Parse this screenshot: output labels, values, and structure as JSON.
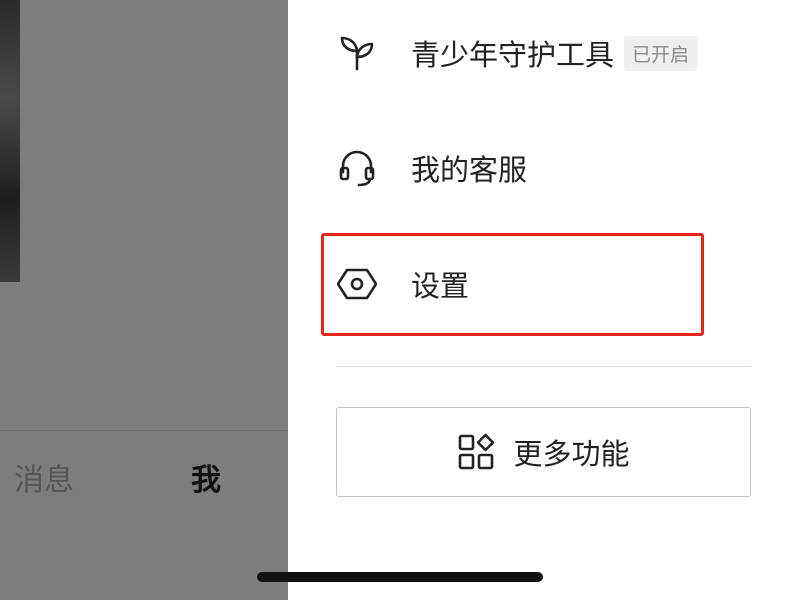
{
  "background_page": {
    "tabs": [
      {
        "label": "消息"
      },
      {
        "label": "我"
      }
    ]
  },
  "drawer": {
    "menu_items": [
      {
        "label": "青少年守护工具",
        "icon": "sprout-icon",
        "badge": "已开启"
      },
      {
        "label": "我的客服",
        "icon": "headset-icon"
      },
      {
        "label": "设置",
        "icon": "settings-hexagon-icon"
      }
    ],
    "more_button": {
      "label": "更多功能",
      "icon": "grid-apps-icon"
    }
  },
  "colors": {
    "highlight": "#e3241f",
    "overlay": "#7d7d7d",
    "badge_bg": "#efefef"
  }
}
